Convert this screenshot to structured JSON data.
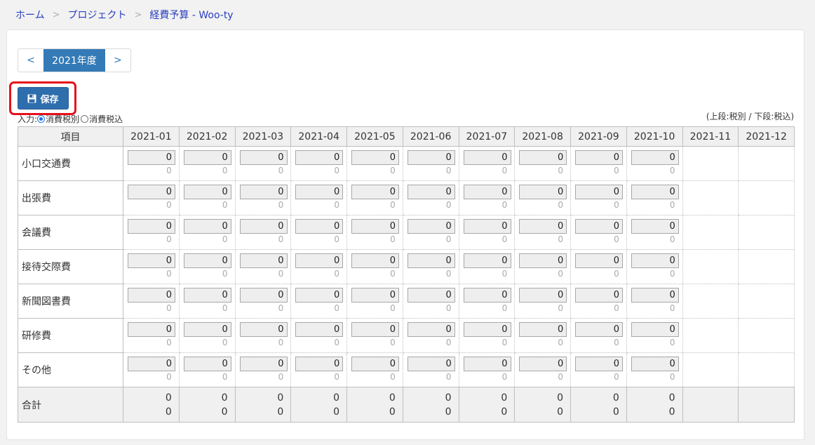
{
  "breadcrumb": {
    "items": [
      "ホーム",
      "プロジェクト",
      "経費予算 - Woo-ty"
    ],
    "separator": ">"
  },
  "year_nav": {
    "prev": "<",
    "year": "2021年度",
    "next": ">"
  },
  "toolbar": {
    "save_label": "保存"
  },
  "input_mode": {
    "label": "入力:",
    "options": [
      {
        "label": "消費税別",
        "checked": true
      },
      {
        "label": "消費税込",
        "checked": false
      }
    ]
  },
  "tax_note": "(上段:税別 / 下段:税込)",
  "table": {
    "item_header": "項目",
    "months": [
      "2021-01",
      "2021-02",
      "2021-03",
      "2021-04",
      "2021-05",
      "2021-06",
      "2021-07",
      "2021-08",
      "2021-09",
      "2021-10",
      "2021-11",
      "2021-12"
    ],
    "editable_months": 10,
    "rows": [
      {
        "label": "小口交通費",
        "values": [
          "0",
          "0",
          "0",
          "0",
          "0",
          "0",
          "0",
          "0",
          "0",
          "0"
        ],
        "tax_included": [
          "0",
          "0",
          "0",
          "0",
          "0",
          "0",
          "0",
          "0",
          "0",
          "0"
        ]
      },
      {
        "label": "出張費",
        "values": [
          "0",
          "0",
          "0",
          "0",
          "0",
          "0",
          "0",
          "0",
          "0",
          "0"
        ],
        "tax_included": [
          "0",
          "0",
          "0",
          "0",
          "0",
          "0",
          "0",
          "0",
          "0",
          "0"
        ]
      },
      {
        "label": "会議費",
        "values": [
          "0",
          "0",
          "0",
          "0",
          "0",
          "0",
          "0",
          "0",
          "0",
          "0"
        ],
        "tax_included": [
          "0",
          "0",
          "0",
          "0",
          "0",
          "0",
          "0",
          "0",
          "0",
          "0"
        ]
      },
      {
        "label": "接待交際費",
        "values": [
          "0",
          "0",
          "0",
          "0",
          "0",
          "0",
          "0",
          "0",
          "0",
          "0"
        ],
        "tax_included": [
          "0",
          "0",
          "0",
          "0",
          "0",
          "0",
          "0",
          "0",
          "0",
          "0"
        ]
      },
      {
        "label": "新聞図書費",
        "values": [
          "0",
          "0",
          "0",
          "0",
          "0",
          "0",
          "0",
          "0",
          "0",
          "0"
        ],
        "tax_included": [
          "0",
          "0",
          "0",
          "0",
          "0",
          "0",
          "0",
          "0",
          "0",
          "0"
        ]
      },
      {
        "label": "研修費",
        "values": [
          "0",
          "0",
          "0",
          "0",
          "0",
          "0",
          "0",
          "0",
          "0",
          "0"
        ],
        "tax_included": [
          "0",
          "0",
          "0",
          "0",
          "0",
          "0",
          "0",
          "0",
          "0",
          "0"
        ]
      },
      {
        "label": "その他",
        "values": [
          "0",
          "0",
          "0",
          "0",
          "0",
          "0",
          "0",
          "0",
          "0",
          "0"
        ],
        "tax_included": [
          "0",
          "0",
          "0",
          "0",
          "0",
          "0",
          "0",
          "0",
          "0",
          "0"
        ]
      }
    ],
    "total": {
      "label": "合計",
      "values": [
        "0",
        "0",
        "0",
        "0",
        "0",
        "0",
        "0",
        "0",
        "0",
        "0"
      ],
      "tax_included": [
        "0",
        "0",
        "0",
        "0",
        "0",
        "0",
        "0",
        "0",
        "0",
        "0"
      ]
    }
  },
  "colors": {
    "accent": "#337ab7",
    "link": "#2a3fbf",
    "highlight": "#e8101a"
  }
}
